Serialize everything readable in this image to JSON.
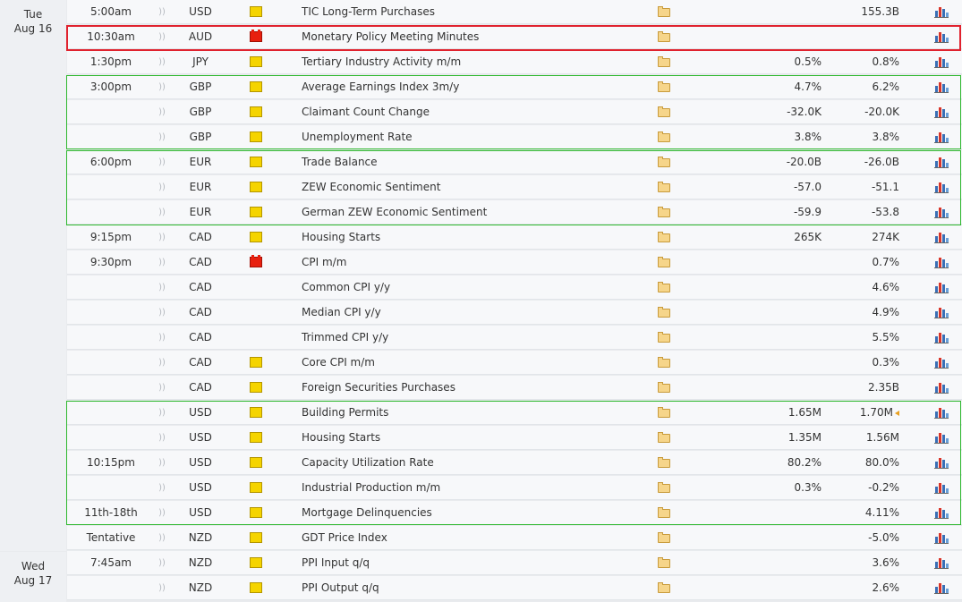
{
  "days": [
    {
      "weekday": "Tue",
      "date": "Aug 16"
    },
    {
      "weekday": "Wed",
      "date": "Aug 17"
    }
  ],
  "colors": {
    "row_bg": "#f7f8fa",
    "highlight_red": "#e0222e",
    "highlight_green": "#2eb82e",
    "impact_low": "#f5d400",
    "impact_medium": "#f0902a",
    "impact_high": "#e8200f"
  },
  "icons": {
    "sound": "sound-icon",
    "impact": "impact-folder-icon",
    "detail": "detail-folder-icon",
    "graph": "graph-icon"
  },
  "events": [
    {
      "time": "5:00am",
      "currency": "USD",
      "impact": "low",
      "name": "TIC Long-Term Purchases",
      "forecast": "",
      "previous": "155.3B"
    },
    {
      "time": "10:30am",
      "currency": "AUD",
      "impact": "high",
      "name": "Monetary Policy Meeting Minutes",
      "forecast": "",
      "previous": ""
    },
    {
      "time": "1:30pm",
      "currency": "JPY",
      "impact": "low",
      "name": "Tertiary Industry Activity m/m",
      "forecast": "0.5%",
      "previous": "0.8%"
    },
    {
      "time": "3:00pm",
      "currency": "GBP",
      "impact": "low",
      "name": "Average Earnings Index 3m/y",
      "forecast": "4.7%",
      "previous": "6.2%"
    },
    {
      "time": "",
      "currency": "GBP",
      "impact": "low",
      "name": "Claimant Count Change",
      "forecast": "-32.0K",
      "previous": "-20.0K"
    },
    {
      "time": "",
      "currency": "GBP",
      "impact": "low",
      "name": "Unemployment Rate",
      "forecast": "3.8%",
      "previous": "3.8%"
    },
    {
      "time": "6:00pm",
      "currency": "EUR",
      "impact": "low",
      "name": "Trade Balance",
      "forecast": "-20.0B",
      "previous": "-26.0B"
    },
    {
      "time": "",
      "currency": "EUR",
      "impact": "low",
      "name": "ZEW Economic Sentiment",
      "forecast": "-57.0",
      "previous": "-51.1"
    },
    {
      "time": "",
      "currency": "EUR",
      "impact": "low",
      "name": "German ZEW Economic Sentiment",
      "forecast": "-59.9",
      "previous": "-53.8"
    },
    {
      "time": "9:15pm",
      "currency": "CAD",
      "impact": "low",
      "name": "Housing Starts",
      "forecast": "265K",
      "previous": "274K"
    },
    {
      "time": "9:30pm",
      "currency": "CAD",
      "impact": "high",
      "name": "CPI m/m",
      "forecast": "",
      "previous": "0.7%"
    },
    {
      "time": "",
      "currency": "CAD",
      "impact": "medium",
      "name": "Common CPI y/y",
      "forecast": "",
      "previous": "4.6%"
    },
    {
      "time": "",
      "currency": "CAD",
      "impact": "medium",
      "name": "Median CPI y/y",
      "forecast": "",
      "previous": "4.9%"
    },
    {
      "time": "",
      "currency": "CAD",
      "impact": "medium",
      "name": "Trimmed CPI y/y",
      "forecast": "",
      "previous": "5.5%"
    },
    {
      "time": "",
      "currency": "CAD",
      "impact": "low",
      "name": "Core CPI m/m",
      "forecast": "",
      "previous": "0.3%"
    },
    {
      "time": "",
      "currency": "CAD",
      "impact": "low",
      "name": "Foreign Securities Purchases",
      "forecast": "",
      "previous": "2.35B"
    },
    {
      "time": "",
      "currency": "USD",
      "impact": "low",
      "name": "Building Permits",
      "forecast": "1.65M",
      "previous": "1.70M",
      "revised": true
    },
    {
      "time": "",
      "currency": "USD",
      "impact": "low",
      "name": "Housing Starts",
      "forecast": "1.35M",
      "previous": "1.56M"
    },
    {
      "time": "10:15pm",
      "currency": "USD",
      "impact": "low",
      "name": "Capacity Utilization Rate",
      "forecast": "80.2%",
      "previous": "80.0%"
    },
    {
      "time": "",
      "currency": "USD",
      "impact": "low",
      "name": "Industrial Production m/m",
      "forecast": "0.3%",
      "previous": "-0.2%"
    },
    {
      "time": "11th-18th",
      "currency": "USD",
      "impact": "low",
      "name": "Mortgage Delinquencies",
      "forecast": "",
      "previous": "4.11%"
    },
    {
      "time": "Tentative",
      "currency": "NZD",
      "impact": "low",
      "name": "GDT Price Index",
      "forecast": "",
      "previous": "-5.0%"
    },
    {
      "time": "7:45am",
      "currency": "NZD",
      "impact": "low",
      "name": "PPI Input q/q",
      "forecast": "",
      "previous": "3.6%"
    },
    {
      "time": "",
      "currency": "NZD",
      "impact": "low",
      "name": "PPI Output q/q",
      "forecast": "",
      "previous": "2.6%"
    }
  ]
}
